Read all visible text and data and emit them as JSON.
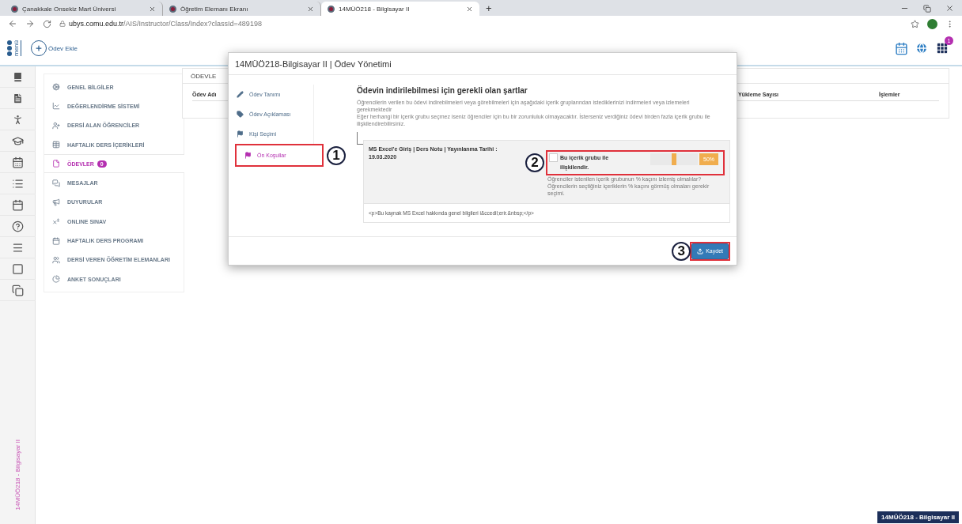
{
  "browser": {
    "tabs": [
      {
        "title": "Çanakkale Onsekiz Mart Üniversi",
        "selected": false
      },
      {
        "title": "Öğretim Elemanı Ekranı",
        "selected": false
      },
      {
        "title": "14MÜÖ218 - Bilgisayar II",
        "selected": true
      }
    ],
    "new_tab": "+",
    "url": {
      "host": "ubys.comu.edu.tr",
      "path": "/AIS/Instructor/Class/Index?classId=489198"
    }
  },
  "header": {
    "logo_text": "menü",
    "add_button": "Ödev Ekle",
    "notification_count": "1"
  },
  "side_menu": [
    {
      "label": "GENEL BİLGİLER",
      "selected": false
    },
    {
      "label": "DEĞERLENDİRME SİSTEMİ",
      "selected": false
    },
    {
      "label": "DERSİ ALAN ÖĞRENCİLER",
      "selected": false
    },
    {
      "label": "HAFTALIK DERS İÇERİKLERİ",
      "selected": false
    },
    {
      "label": "ÖDEVLER",
      "selected": true,
      "badge": "0"
    },
    {
      "label": "MESAJLAR",
      "selected": false
    },
    {
      "label": "DUYURULAR",
      "selected": false
    },
    {
      "label": "ONLINE SINAV",
      "selected": false
    },
    {
      "label": "HAFTALIK DERS PROGRAMI",
      "selected": false
    },
    {
      "label": "DERSİ VEREN ÖĞRETİM ELEMANLARI",
      "selected": false
    },
    {
      "label": "ANKET SONUÇLARI",
      "selected": false
    }
  ],
  "panel": {
    "title": "ÖDEVLE",
    "column_1": "Ödev Adı",
    "column_3": "Yükleme Sayısı",
    "column_4": "İşlemler"
  },
  "modal": {
    "title": "14MÜÖ218-Bilgisayar II | Ödev Yönetimi",
    "nav": [
      {
        "label": "Ödev Tanımı",
        "selected": false
      },
      {
        "label": "Ödev Açıklaması",
        "selected": false
      },
      {
        "label": "Kişi Seçimi",
        "selected": false
      },
      {
        "label": "Ön Koşullar",
        "selected": true
      }
    ],
    "heading": "Ödevin indirilebilmesi için gerekli olan şartlar",
    "description": [
      "Öğrencilerin verilen bu ödevi indirebilmeleri veya görebilmeleri için aşağıdaki içerik gruplarından istediklerinizi indirmeleri veya izlemeleri gerekmektedir",
      "Eğer herhangi bir içerik grubu seçmez iseniz öğrenciler için bu bir zorunluluk olmayacaktır. İsterseniz verdiğiniz ödevi birden fazla içerik grubu ile ilişkilendirebilirsiniz."
    ],
    "content_group": {
      "title": "MS Excel'e Giriş | Ders Notu | Yayınlanma Tarihi : 19.03.2020",
      "checked": false,
      "checkbox_label": "Bu içerik grubu ile ilişkilendir.",
      "level": 0.5,
      "percent": "50%",
      "help": [
        "Öğrenciler istenilen içerik grubunun % kaçını izlemiş olmalılar?",
        "Öğrencilerin seçtiğiniz içeriklerin % kaçını görmüş olmaları gerekir seçimi."
      ],
      "body": "<p>Bu kaynak MS Excel hakkında genel bilgileri i&ccedil;erir.&nbsp;</p>"
    },
    "save_button": "Kaydet"
  },
  "annotations": [
    {
      "number": "1"
    },
    {
      "number": "2"
    },
    {
      "number": "3"
    }
  ],
  "sidebar_caption": "14MÜÖ218 - Bilgisayar II",
  "footer_badge": "14MÜÖ218 - Bilgisayar II"
}
